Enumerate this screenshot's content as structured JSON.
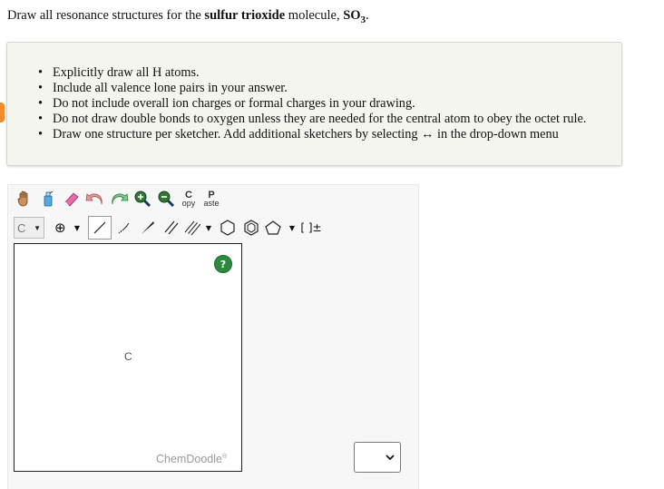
{
  "question": {
    "prefix": "Draw all resonance structures for the ",
    "bold_term": "sulfur trioxide",
    "middle": " molecule, ",
    "formula_main": "SO",
    "formula_sub": "3",
    "suffix": "."
  },
  "instructions": [
    "Explicitly draw all H atoms.",
    "Include all valence lone pairs in your answer.",
    "Do not include overall ion charges or formal charges in your drawing.",
    "Do not draw double bonds to oxygen unless they are needed for the central atom to obey the octet rule.",
    "Draw one structure per sketcher. Add additional sketchers by selecting ↔ in the drop-down menu"
  ],
  "toolbar": {
    "copy_top": "C",
    "copy_bottom": "opy",
    "paste_top": "P",
    "paste_bottom": "aste",
    "element_label": "C",
    "charge_symbol": "⊕",
    "bracket_label": "[ ]±"
  },
  "canvas": {
    "atom_label": "C",
    "help_label": "?",
    "brand": "ChemDoodle",
    "brand_mark": "®"
  },
  "dropdown": {
    "selected": ""
  },
  "colors": {
    "accent_orange": "#f08c2c",
    "help_green": "#2b8a3e",
    "note_bg": "#f5f5ef"
  }
}
